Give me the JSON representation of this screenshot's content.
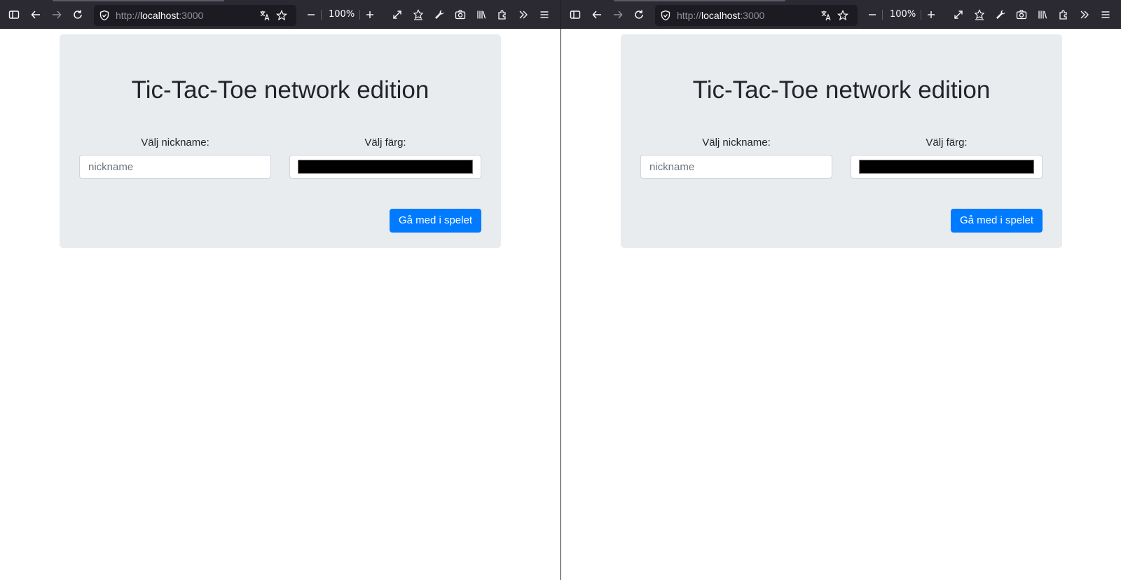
{
  "browser": {
    "url_protocol": "http://",
    "url_host": "localhost",
    "url_port": ":3000",
    "zoom": "100%"
  },
  "page": {
    "title": "Tic-Tac-Toe network edition",
    "nickname_label": "Välj nickname:",
    "nickname_placeholder": "nickname",
    "nickname_value": "",
    "color_label": "Välj färg:",
    "color_value": "#000000",
    "join_button": "Gå med i spelet"
  },
  "colors": {
    "toolbar_bg": "#2b2a33",
    "jumbotron_bg": "#e9ecef",
    "primary": "#007bff"
  }
}
